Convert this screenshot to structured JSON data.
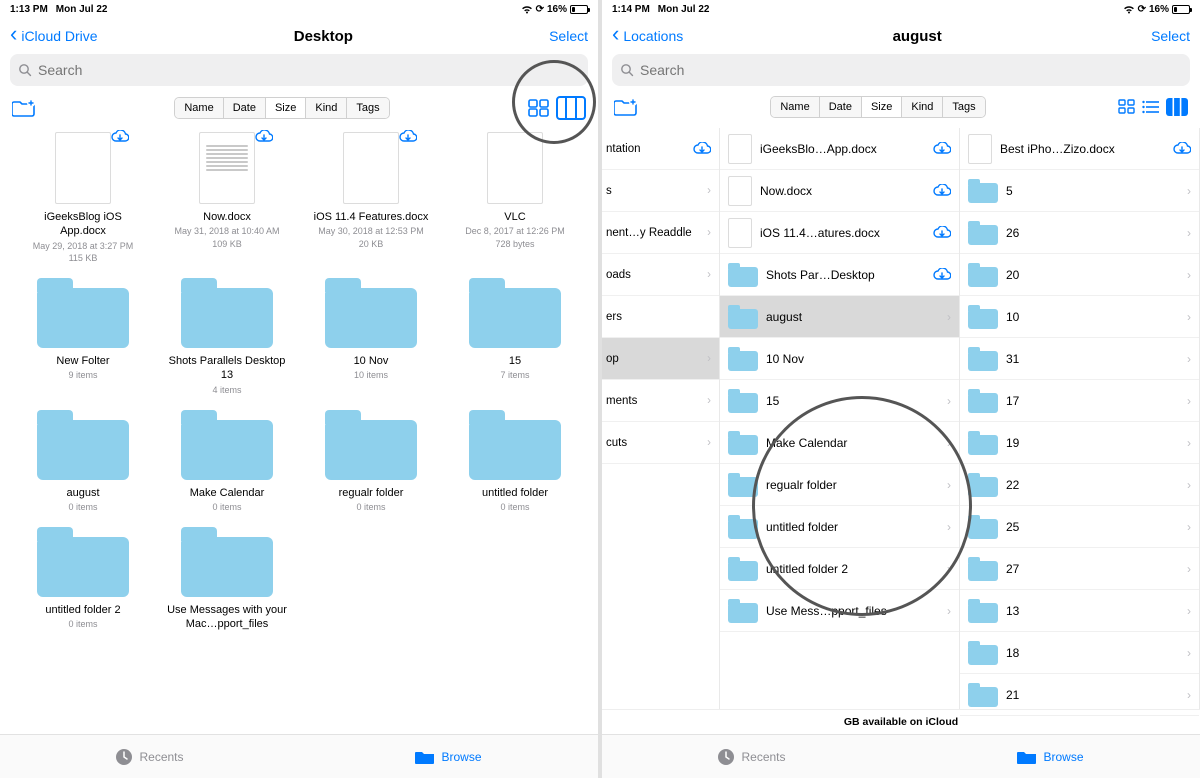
{
  "left": {
    "status": {
      "time": "1:13 PM",
      "day": "Mon Jul 22",
      "batt": "16%"
    },
    "back": "iCloud Drive",
    "title": "Desktop",
    "select": "Select",
    "search_ph": "Search",
    "sort": [
      "Name",
      "Date",
      "Size",
      "Kind",
      "Tags"
    ],
    "sort_active": 2,
    "items": [
      {
        "name": "iGeeksBlog iOS App.docx",
        "sub1": "May 29, 2018 at 3:27 PM",
        "sub2": "115 KB",
        "type": "doc",
        "cloud": true
      },
      {
        "name": "Now.docx",
        "sub1": "May 31, 2018 at 10:40 AM",
        "sub2": "109 KB",
        "type": "doc",
        "cloud": true,
        "text": true
      },
      {
        "name": "iOS 11.4  Features.docx",
        "sub1": "May 30, 2018 at 12:53 PM",
        "sub2": "20 KB",
        "type": "doc",
        "cloud": true
      },
      {
        "name": "VLC",
        "sub1": "Dec 8, 2017 at 12:26 PM",
        "sub2": "728 bytes",
        "type": "doc",
        "cloud": false
      },
      {
        "name": "New Folter",
        "sub1": "9 items",
        "type": "folder"
      },
      {
        "name": "Shots Parallels Desktop 13",
        "sub1": "4 items",
        "type": "folder"
      },
      {
        "name": "10 Nov",
        "sub1": "10 items",
        "type": "folder"
      },
      {
        "name": "15",
        "sub1": "7 items",
        "type": "folder"
      },
      {
        "name": "august",
        "sub1": "0 items",
        "type": "folder"
      },
      {
        "name": "Make Calendar",
        "sub1": "0 items",
        "type": "folder"
      },
      {
        "name": "regualr folder",
        "sub1": "0 items",
        "type": "folder"
      },
      {
        "name": "untitled folder",
        "sub1": "0 items",
        "type": "folder"
      },
      {
        "name": "untitled folder 2",
        "sub1": "0 items",
        "type": "folder"
      },
      {
        "name": "Use Messages with your Mac…pport_files",
        "sub1": "",
        "type": "folder"
      }
    ],
    "tabs": {
      "recents": "Recents",
      "browse": "Browse"
    }
  },
  "right": {
    "status": {
      "time": "1:14 PM",
      "day": "Mon Jul 22",
      "batt": "16%"
    },
    "back": "Locations",
    "title": "august",
    "select": "Select",
    "search_ph": "Search",
    "sort": [
      "Name",
      "Date",
      "Size",
      "Kind",
      "Tags"
    ],
    "sort_active": 2,
    "col0": [
      {
        "label": "ntation",
        "cloud": true
      },
      {
        "label": "s",
        "chev": true
      },
      {
        "label": "nent…y Readdle",
        "chev": true
      },
      {
        "label": "oads",
        "chev": true
      },
      {
        "label": "ers"
      },
      {
        "label": "op",
        "chev": true,
        "sel": true
      },
      {
        "label": "ments",
        "chev": true
      },
      {
        "label": "cuts",
        "chev": true
      }
    ],
    "col1": [
      {
        "label": "iGeeksBlo…App.docx",
        "cloud": true,
        "doc": true
      },
      {
        "label": "Now.docx",
        "cloud": true,
        "doc": true
      },
      {
        "label": "iOS 11.4…atures.docx",
        "cloud": true,
        "doc": true
      },
      {
        "label": "Shots Par…Desktop",
        "folder": true,
        "cloud": true
      },
      {
        "label": "august",
        "folder": true,
        "sel": true,
        "chev": true
      },
      {
        "label": "10 Nov",
        "folder": true
      },
      {
        "label": "15",
        "folder": true,
        "chev": true
      },
      {
        "label": "Make Calendar",
        "folder": true,
        "chev": true
      },
      {
        "label": "regualr folder",
        "folder": true,
        "chev": true
      },
      {
        "label": "untitled folder",
        "folder": true,
        "chev": true
      },
      {
        "label": "untitled folder 2",
        "folder": true,
        "chev": true
      },
      {
        "label": "Use Mess…pport_files",
        "folder": true,
        "chev": true
      }
    ],
    "col2": [
      {
        "label": "Best iPho…Zizo.docx",
        "cloud": true,
        "doc": true
      },
      {
        "label": "5",
        "folder": true,
        "chev": true
      },
      {
        "label": "26",
        "folder": true,
        "chev": true
      },
      {
        "label": "20",
        "folder": true,
        "chev": true
      },
      {
        "label": "10",
        "folder": true,
        "chev": true
      },
      {
        "label": "31",
        "folder": true,
        "chev": true
      },
      {
        "label": "17",
        "folder": true,
        "chev": true
      },
      {
        "label": "19",
        "folder": true,
        "chev": true
      },
      {
        "label": "22",
        "folder": true,
        "chev": true
      },
      {
        "label": "25",
        "folder": true,
        "chev": true
      },
      {
        "label": "27",
        "folder": true,
        "chev": true
      },
      {
        "label": "13",
        "folder": true,
        "chev": true
      },
      {
        "label": "18",
        "folder": true,
        "chev": true
      },
      {
        "label": "21",
        "folder": true,
        "chev": true
      }
    ],
    "storage_text": "GB available on iCloud",
    "tabs": {
      "recents": "Recents",
      "browse": "Browse"
    }
  }
}
